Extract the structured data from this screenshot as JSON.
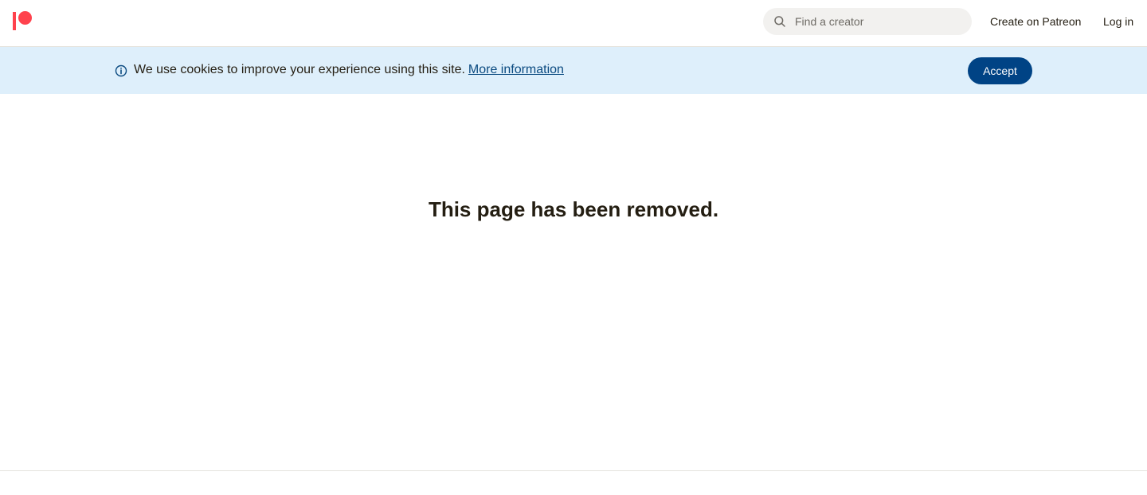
{
  "brand": {
    "logo_icon": "patreon-logo-icon",
    "color": "#ff424d"
  },
  "header": {
    "search": {
      "placeholder": "Find a creator",
      "value": "",
      "icon": "search-icon"
    },
    "create_link": "Create on Patreon",
    "login_link": "Log in"
  },
  "cookie_banner": {
    "icon": "info-icon",
    "message": "We use cookies to improve your experience using this site.",
    "link_text": "More information",
    "accept_label": "Accept",
    "background_color": "#deeffb",
    "accept_color": "#004385"
  },
  "main": {
    "title": "This page has been removed."
  }
}
